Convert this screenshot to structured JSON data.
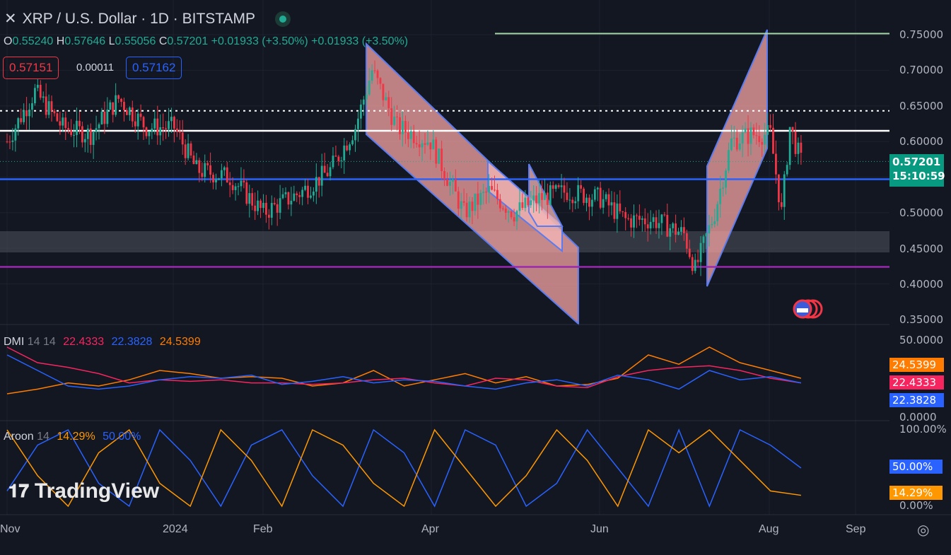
{
  "header": {
    "symbol_icon": "xrp-x-icon",
    "title": "XRP / U.S. Dollar · 1D · BITSTAMP",
    "market_status": "open"
  },
  "ohlc": {
    "o_label": "O",
    "o": "0.55240",
    "h_label": "H",
    "h": "0.57646",
    "l_label": "L",
    "l": "0.55056",
    "c_label": "C",
    "c": "0.57201",
    "change": "+0.01933 (+3.50%)",
    "change2": "+0.01933 (+3.50%)"
  },
  "trade": {
    "sell": "0.57151",
    "spread": "0.00011",
    "buy": "0.57162"
  },
  "price_axis": [
    "0.75000",
    "0.70000",
    "0.65000",
    "0.60000",
    "0.50000",
    "0.45000",
    "0.40000",
    "0.35000"
  ],
  "current": {
    "price": "0.57201",
    "countdown": "15:10:59"
  },
  "dmi": {
    "label": "DMI",
    "params": "14 14",
    "plus_di": "22.4333",
    "minus_di": "22.3828",
    "adx": "24.5399",
    "axis": [
      "50.0000",
      "0.0000"
    ]
  },
  "aroon": {
    "label": "Aroon",
    "params": "14",
    "up": "14.29%",
    "down": "50.00%",
    "axis": [
      "100.00%",
      "0.00%"
    ]
  },
  "time_axis": [
    "Nov",
    "2024",
    "Feb",
    "Apr",
    "Jun",
    "Aug",
    "Sep"
  ],
  "watermark": "TradingView",
  "colors": {
    "up": "#22ab94",
    "down": "#f23645",
    "plus": "#f7255f",
    "minus": "#2962ff",
    "adx": "#ff7c00",
    "aroon_up": "#ff9800",
    "aroon_down": "#2962ff"
  },
  "chart_data": {
    "type": "candlestick",
    "title": "XRP / U.S. Dollar · 1D · BITSTAMP",
    "x_unit": "days since Nov 1 2023",
    "ylim": [
      0.35,
      0.76
    ],
    "close_path": [
      [
        0,
        0.6
      ],
      [
        10,
        0.67
      ],
      [
        20,
        0.62
      ],
      [
        30,
        0.61
      ],
      [
        40,
        0.66
      ],
      [
        50,
        0.62
      ],
      [
        60,
        0.62
      ],
      [
        68,
        0.56
      ],
      [
        80,
        0.55
      ],
      [
        92,
        0.5
      ],
      [
        106,
        0.53
      ],
      [
        116,
        0.56
      ],
      [
        125,
        0.62
      ],
      [
        131,
        0.7
      ],
      [
        140,
        0.62
      ],
      [
        152,
        0.6
      ],
      [
        164,
        0.5
      ],
      [
        173,
        0.53
      ],
      [
        182,
        0.5
      ],
      [
        191,
        0.52
      ],
      [
        201,
        0.53
      ],
      [
        213,
        0.52
      ],
      [
        222,
        0.49
      ],
      [
        232,
        0.49
      ],
      [
        243,
        0.47
      ],
      [
        247,
        0.42
      ],
      [
        254,
        0.5
      ],
      [
        260,
        0.6
      ],
      [
        267,
        0.61
      ],
      [
        274,
        0.61
      ],
      [
        278,
        0.5
      ],
      [
        281,
        0.62
      ],
      [
        285,
        0.572
      ]
    ],
    "horizontal_levels": [
      0.7515,
      0.643,
      0.615,
      0.547,
      0.424
    ],
    "zone": [
      0.445,
      0.475
    ],
    "dmi_plus": [
      45,
      35,
      32,
      28,
      22,
      24,
      23,
      24,
      22,
      22,
      21,
      22,
      24,
      25,
      22,
      20,
      25,
      24,
      20,
      19,
      26,
      30,
      32,
      33,
      30,
      25,
      22
    ],
    "dmi_minus": [
      40,
      30,
      20,
      18,
      20,
      24,
      26,
      25,
      27,
      21,
      23,
      26,
      22,
      24,
      23,
      20,
      18,
      22,
      24,
      20,
      27,
      24,
      18,
      30,
      24,
      26,
      22
    ],
    "dmi_adx": [
      15,
      18,
      22,
      20,
      24,
      30,
      28,
      25,
      26,
      25,
      20,
      22,
      30,
      20,
      24,
      28,
      22,
      26,
      20,
      21,
      25,
      40,
      34,
      45,
      35,
      30,
      25
    ],
    "aroon_up": [
      100,
      40,
      0,
      70,
      100,
      30,
      0,
      100,
      60,
      0,
      100,
      80,
      30,
      0,
      100,
      50,
      0,
      40,
      100,
      60,
      0,
      100,
      70,
      100,
      60,
      20,
      14.29
    ],
    "aroon_down": [
      20,
      80,
      100,
      30,
      0,
      100,
      60,
      0,
      80,
      100,
      40,
      0,
      100,
      70,
      0,
      100,
      80,
      0,
      30,
      100,
      50,
      0,
      100,
      0,
      100,
      80,
      50
    ]
  }
}
